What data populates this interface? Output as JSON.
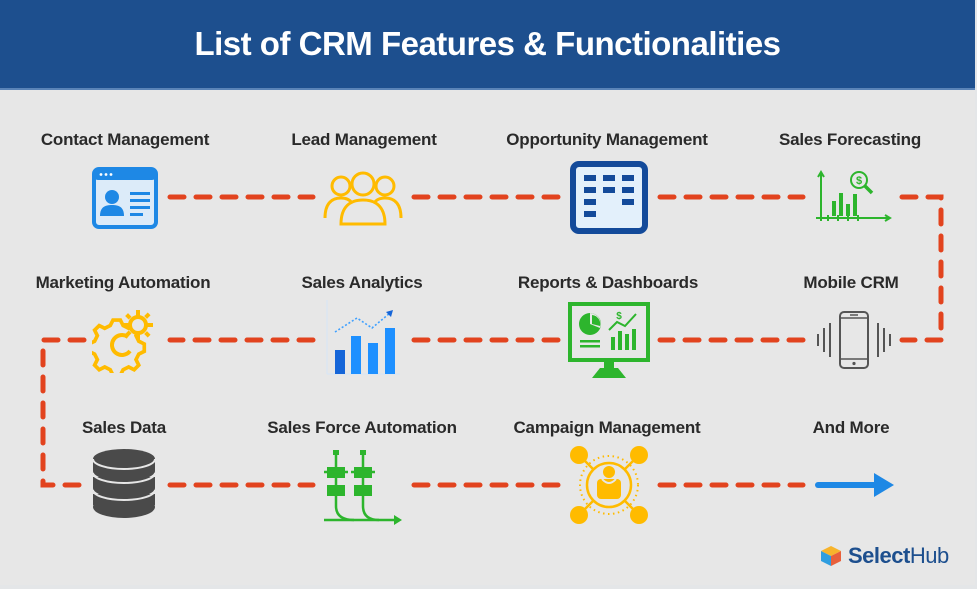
{
  "title": "List of CRM Features & Functionalities",
  "colors": {
    "header_bg": "#1d4f8e",
    "connector": "#e2431e",
    "blue_icon": "#1e88e5",
    "yellow_icon": "#ffbb00",
    "green_icon": "#2db52d",
    "dark_icon": "#4a4a4a",
    "navy_icon": "#134a9a"
  },
  "features": [
    {
      "label": "Contact Management",
      "icon": "contact-card-icon"
    },
    {
      "label": "Lead Management",
      "icon": "people-group-icon"
    },
    {
      "label": "Opportunity Management",
      "icon": "spreadsheet-grid-icon"
    },
    {
      "label": "Sales Forecasting",
      "icon": "forecast-chart-icon"
    },
    {
      "label": "Mobile CRM",
      "icon": "mobile-phone-icon"
    },
    {
      "label": "Reports & Dashboards",
      "icon": "dashboard-monitor-icon"
    },
    {
      "label": "Sales Analytics",
      "icon": "bar-chart-trend-icon"
    },
    {
      "label": "Marketing Automation",
      "icon": "gears-icon"
    },
    {
      "label": "Sales Data",
      "icon": "database-icon"
    },
    {
      "label": "Sales Force Automation",
      "icon": "workflow-pipeline-icon"
    },
    {
      "label": "Campaign Management",
      "icon": "campaign-network-icon"
    },
    {
      "label": "And More",
      "icon": "arrow-right-icon"
    }
  ],
  "logo": {
    "bold": "Select",
    "regular": "Hub"
  }
}
